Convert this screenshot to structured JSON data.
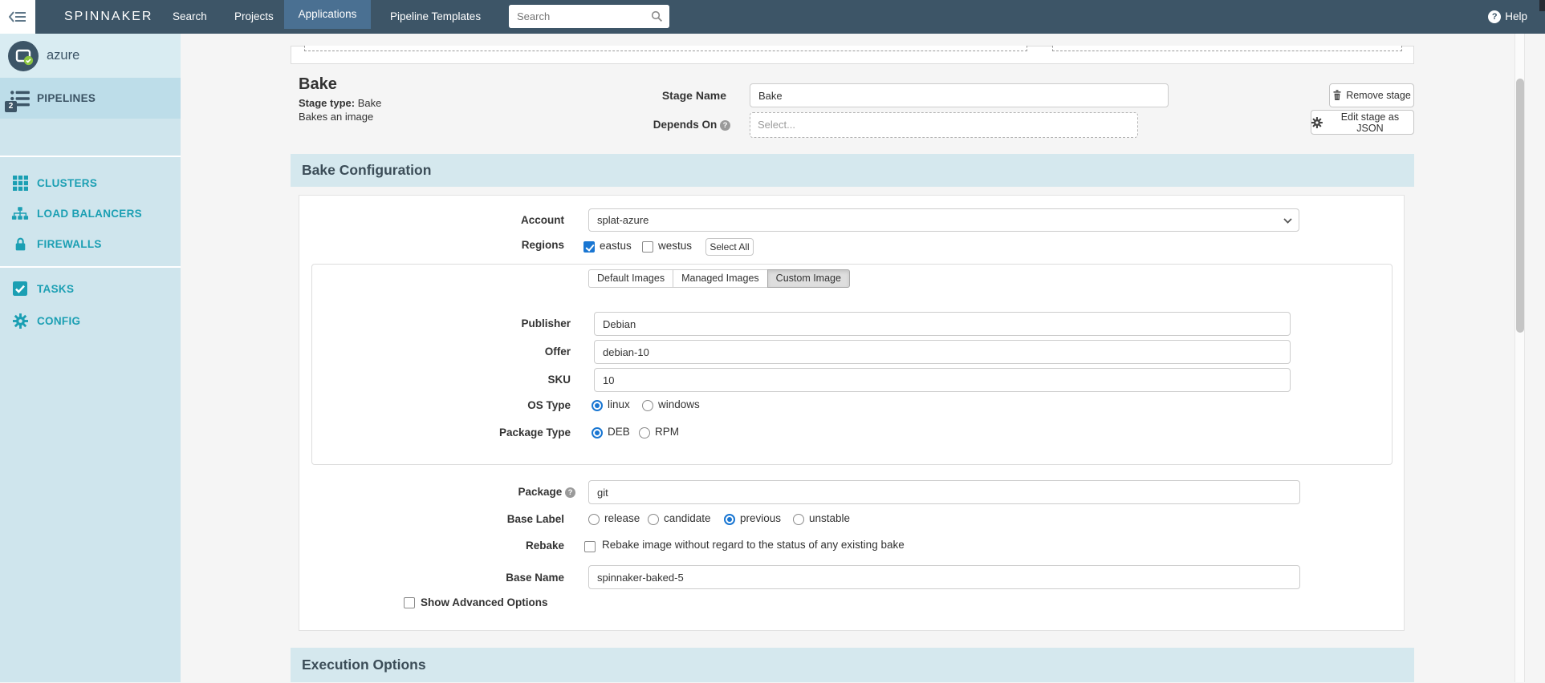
{
  "navbar": {
    "brand": "SPINNAKER",
    "items": [
      {
        "label": "Search",
        "active": false
      },
      {
        "label": "Projects",
        "active": false
      },
      {
        "label": "Applications",
        "active": true
      },
      {
        "label": "Pipeline Templates",
        "active": false
      }
    ],
    "search_placeholder": "Search",
    "help_label": "Help"
  },
  "icons": {
    "question_mark": "?"
  },
  "sidebar": {
    "app_name": "azure",
    "pipelines": {
      "label": "PIPELINES",
      "badge": "2"
    },
    "items": [
      {
        "label": "CLUSTERS"
      },
      {
        "label": "LOAD BALANCERS"
      },
      {
        "label": "FIREWALLS"
      },
      {
        "label": "TASKS"
      },
      {
        "label": "CONFIG"
      }
    ]
  },
  "stage_header": {
    "title": "Bake",
    "stage_type_label": "Stage type:",
    "stage_type_value": "Bake",
    "description": "Bakes an image",
    "stage_name_label": "Stage Name",
    "stage_name_value": "Bake",
    "depends_on_label": "Depends On",
    "depends_on_placeholder": "Select...",
    "remove_stage_label": "Remove stage",
    "edit_json_label": "Edit stage as JSON"
  },
  "bake_config": {
    "section_title": "Bake Configuration",
    "account_label": "Account",
    "account_value": "splat-azure",
    "regions_label": "Regions",
    "regions": [
      {
        "label": "eastus",
        "checked": true
      },
      {
        "label": "westus",
        "checked": false
      }
    ],
    "select_all_label": "Select All",
    "image_tabs": [
      {
        "label": "Default Images",
        "active": false
      },
      {
        "label": "Managed Images",
        "active": false
      },
      {
        "label": "Custom Image",
        "active": true
      }
    ],
    "publisher_label": "Publisher",
    "publisher_value": "Debian",
    "offer_label": "Offer",
    "offer_value": "debian-10",
    "sku_label": "SKU",
    "sku_value": "10",
    "os_type_label": "OS Type",
    "os_type_options": [
      {
        "label": "linux",
        "selected": true
      },
      {
        "label": "windows",
        "selected": false
      }
    ],
    "package_type_label": "Package Type",
    "package_type_options": [
      {
        "label": "DEB",
        "selected": true
      },
      {
        "label": "RPM",
        "selected": false
      }
    ],
    "package_label": "Package",
    "package_value": "git",
    "base_label_label": "Base Label",
    "base_label_options": [
      {
        "label": "release",
        "selected": false
      },
      {
        "label": "candidate",
        "selected": false
      },
      {
        "label": "previous",
        "selected": true
      },
      {
        "label": "unstable",
        "selected": false
      }
    ],
    "rebake_label": "Rebake",
    "rebake_checkbox_label": "Rebake image without regard to the status of any existing bake",
    "rebake_checked": false,
    "base_name_label": "Base Name",
    "base_name_value": "spinnaker-baked-5",
    "show_advanced_label": "Show Advanced Options",
    "show_advanced_checked": false
  },
  "execution_options": {
    "section_title": "Execution Options"
  },
  "colors": {
    "navbar_bg": "#3d5567",
    "navbar_active_tab": "#4a7092",
    "sidebar_bg": "#cfe5ed",
    "sidebar_active_bg": "#bddde9",
    "sidebar_accent_teal": "#1b9fb3",
    "section_header_bg": "#d5e8ee",
    "control_accent_blue": "#1976d2",
    "page_bg": "#f5f5f5"
  }
}
